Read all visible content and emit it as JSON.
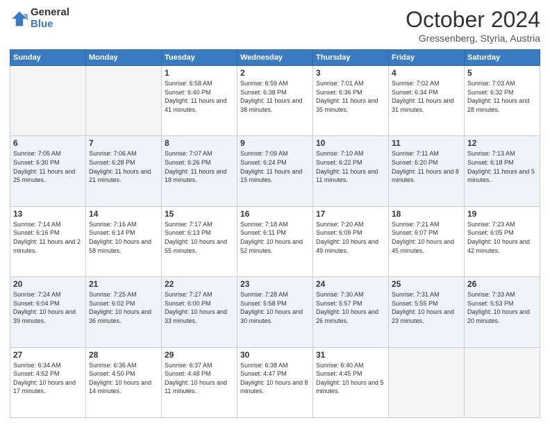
{
  "header": {
    "logo_general": "General",
    "logo_blue": "Blue",
    "month": "October 2024",
    "location": "Gressenberg, Styria, Austria"
  },
  "weekdays": [
    "Sunday",
    "Monday",
    "Tuesday",
    "Wednesday",
    "Thursday",
    "Friday",
    "Saturday"
  ],
  "weeks": [
    [
      {
        "day": "",
        "sunrise": "",
        "sunset": "",
        "daylight": "",
        "empty": true
      },
      {
        "day": "",
        "sunrise": "",
        "sunset": "",
        "daylight": "",
        "empty": true
      },
      {
        "day": "1",
        "sunrise": "Sunrise: 6:58 AM",
        "sunset": "Sunset: 6:40 PM",
        "daylight": "Daylight: 11 hours and 41 minutes.",
        "empty": false
      },
      {
        "day": "2",
        "sunrise": "Sunrise: 6:59 AM",
        "sunset": "Sunset: 6:38 PM",
        "daylight": "Daylight: 11 hours and 38 minutes.",
        "empty": false
      },
      {
        "day": "3",
        "sunrise": "Sunrise: 7:01 AM",
        "sunset": "Sunset: 6:36 PM",
        "daylight": "Daylight: 11 hours and 35 minutes.",
        "empty": false
      },
      {
        "day": "4",
        "sunrise": "Sunrise: 7:02 AM",
        "sunset": "Sunset: 6:34 PM",
        "daylight": "Daylight: 11 hours and 31 minutes.",
        "empty": false
      },
      {
        "day": "5",
        "sunrise": "Sunrise: 7:03 AM",
        "sunset": "Sunset: 6:32 PM",
        "daylight": "Daylight: 11 hours and 28 minutes.",
        "empty": false
      }
    ],
    [
      {
        "day": "6",
        "sunrise": "Sunrise: 7:05 AM",
        "sunset": "Sunset: 6:30 PM",
        "daylight": "Daylight: 11 hours and 25 minutes.",
        "empty": false
      },
      {
        "day": "7",
        "sunrise": "Sunrise: 7:06 AM",
        "sunset": "Sunset: 6:28 PM",
        "daylight": "Daylight: 11 hours and 21 minutes.",
        "empty": false
      },
      {
        "day": "8",
        "sunrise": "Sunrise: 7:07 AM",
        "sunset": "Sunset: 6:26 PM",
        "daylight": "Daylight: 11 hours and 18 minutes.",
        "empty": false
      },
      {
        "day": "9",
        "sunrise": "Sunrise: 7:09 AM",
        "sunset": "Sunset: 6:24 PM",
        "daylight": "Daylight: 11 hours and 15 minutes.",
        "empty": false
      },
      {
        "day": "10",
        "sunrise": "Sunrise: 7:10 AM",
        "sunset": "Sunset: 6:22 PM",
        "daylight": "Daylight: 11 hours and 11 minutes.",
        "empty": false
      },
      {
        "day": "11",
        "sunrise": "Sunrise: 7:11 AM",
        "sunset": "Sunset: 6:20 PM",
        "daylight": "Daylight: 11 hours and 8 minutes.",
        "empty": false
      },
      {
        "day": "12",
        "sunrise": "Sunrise: 7:13 AM",
        "sunset": "Sunset: 6:18 PM",
        "daylight": "Daylight: 11 hours and 5 minutes.",
        "empty": false
      }
    ],
    [
      {
        "day": "13",
        "sunrise": "Sunrise: 7:14 AM",
        "sunset": "Sunset: 6:16 PM",
        "daylight": "Daylight: 11 hours and 2 minutes.",
        "empty": false
      },
      {
        "day": "14",
        "sunrise": "Sunrise: 7:16 AM",
        "sunset": "Sunset: 6:14 PM",
        "daylight": "Daylight: 10 hours and 58 minutes.",
        "empty": false
      },
      {
        "day": "15",
        "sunrise": "Sunrise: 7:17 AM",
        "sunset": "Sunset: 6:13 PM",
        "daylight": "Daylight: 10 hours and 55 minutes.",
        "empty": false
      },
      {
        "day": "16",
        "sunrise": "Sunrise: 7:18 AM",
        "sunset": "Sunset: 6:11 PM",
        "daylight": "Daylight: 10 hours and 52 minutes.",
        "empty": false
      },
      {
        "day": "17",
        "sunrise": "Sunrise: 7:20 AM",
        "sunset": "Sunset: 6:09 PM",
        "daylight": "Daylight: 10 hours and 49 minutes.",
        "empty": false
      },
      {
        "day": "18",
        "sunrise": "Sunrise: 7:21 AM",
        "sunset": "Sunset: 6:07 PM",
        "daylight": "Daylight: 10 hours and 45 minutes.",
        "empty": false
      },
      {
        "day": "19",
        "sunrise": "Sunrise: 7:23 AM",
        "sunset": "Sunset: 6:05 PM",
        "daylight": "Daylight: 10 hours and 42 minutes.",
        "empty": false
      }
    ],
    [
      {
        "day": "20",
        "sunrise": "Sunrise: 7:24 AM",
        "sunset": "Sunset: 6:04 PM",
        "daylight": "Daylight: 10 hours and 39 minutes.",
        "empty": false
      },
      {
        "day": "21",
        "sunrise": "Sunrise: 7:25 AM",
        "sunset": "Sunset: 6:02 PM",
        "daylight": "Daylight: 10 hours and 36 minutes.",
        "empty": false
      },
      {
        "day": "22",
        "sunrise": "Sunrise: 7:27 AM",
        "sunset": "Sunset: 6:00 PM",
        "daylight": "Daylight: 10 hours and 33 minutes.",
        "empty": false
      },
      {
        "day": "23",
        "sunrise": "Sunrise: 7:28 AM",
        "sunset": "Sunset: 5:58 PM",
        "daylight": "Daylight: 10 hours and 30 minutes.",
        "empty": false
      },
      {
        "day": "24",
        "sunrise": "Sunrise: 7:30 AM",
        "sunset": "Sunset: 5:57 PM",
        "daylight": "Daylight: 10 hours and 26 minutes.",
        "empty": false
      },
      {
        "day": "25",
        "sunrise": "Sunrise: 7:31 AM",
        "sunset": "Sunset: 5:55 PM",
        "daylight": "Daylight: 10 hours and 23 minutes.",
        "empty": false
      },
      {
        "day": "26",
        "sunrise": "Sunrise: 7:33 AM",
        "sunset": "Sunset: 5:53 PM",
        "daylight": "Daylight: 10 hours and 20 minutes.",
        "empty": false
      }
    ],
    [
      {
        "day": "27",
        "sunrise": "Sunrise: 6:34 AM",
        "sunset": "Sunset: 4:52 PM",
        "daylight": "Daylight: 10 hours and 17 minutes.",
        "empty": false
      },
      {
        "day": "28",
        "sunrise": "Sunrise: 6:36 AM",
        "sunset": "Sunset: 4:50 PM",
        "daylight": "Daylight: 10 hours and 14 minutes.",
        "empty": false
      },
      {
        "day": "29",
        "sunrise": "Sunrise: 6:37 AM",
        "sunset": "Sunset: 4:48 PM",
        "daylight": "Daylight: 10 hours and 11 minutes.",
        "empty": false
      },
      {
        "day": "30",
        "sunrise": "Sunrise: 6:38 AM",
        "sunset": "Sunset: 4:47 PM",
        "daylight": "Daylight: 10 hours and 8 minutes.",
        "empty": false
      },
      {
        "day": "31",
        "sunrise": "Sunrise: 6:40 AM",
        "sunset": "Sunset: 4:45 PM",
        "daylight": "Daylight: 10 hours and 5 minutes.",
        "empty": false
      },
      {
        "day": "",
        "sunrise": "",
        "sunset": "",
        "daylight": "",
        "empty": true
      },
      {
        "day": "",
        "sunrise": "",
        "sunset": "",
        "daylight": "",
        "empty": true
      }
    ]
  ],
  "row_classes": [
    "row-white",
    "row-blue",
    "row-white",
    "row-blue",
    "row-white"
  ]
}
